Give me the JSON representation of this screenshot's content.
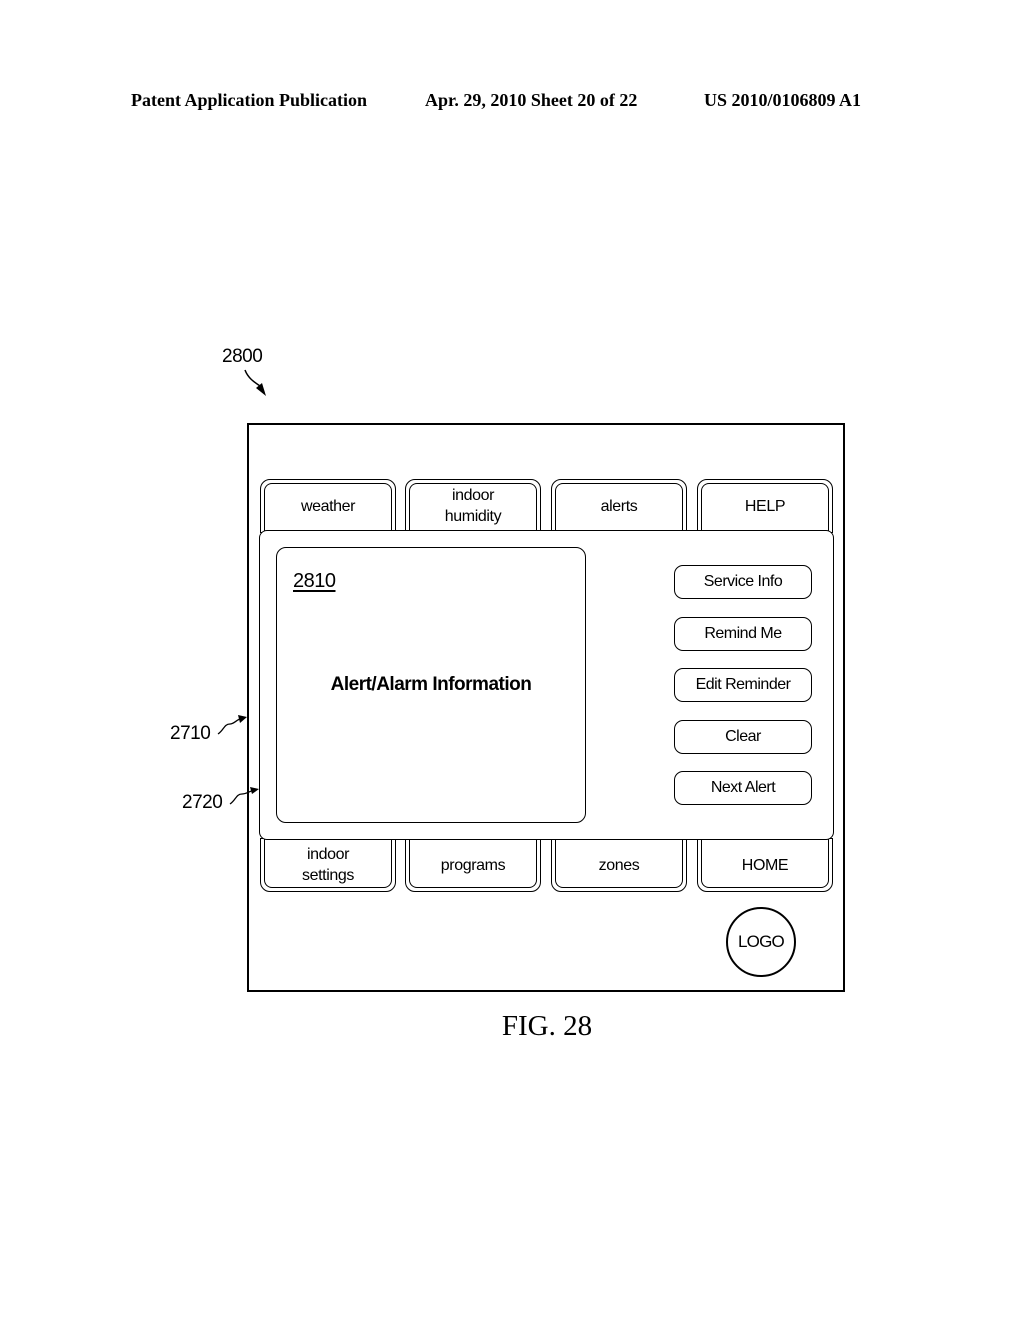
{
  "header": {
    "publication": "Patent Application Publication",
    "date_sheet": "Apr. 29, 2010  Sheet 20 of 22",
    "number": "US 2010/0106809 A1"
  },
  "reference_labels": {
    "figure_ref": "2800",
    "outer_ref": "2710",
    "panel_ref": "2720"
  },
  "top_tabs": [
    {
      "line1": "weather",
      "line2": ""
    },
    {
      "line1": "indoor",
      "line2": "humidity"
    },
    {
      "line1": "alerts",
      "line2": ""
    },
    {
      "line1": "HELP",
      "line2": ""
    }
  ],
  "info_box": {
    "ref": "2810",
    "title": "Alert/Alarm Information"
  },
  "action_buttons": [
    {
      "label": "Service Info"
    },
    {
      "label": "Remind Me"
    },
    {
      "label": "Edit Reminder"
    },
    {
      "label": "Clear"
    },
    {
      "label": "Next Alert"
    }
  ],
  "bottom_tabs": [
    {
      "line1": "indoor",
      "line2": "settings"
    },
    {
      "line1": "programs",
      "line2": ""
    },
    {
      "line1": "zones",
      "line2": ""
    },
    {
      "line1": "HOME",
      "line2": ""
    }
  ],
  "logo": {
    "label": "LOGO"
  },
  "caption": "FIG. 28"
}
